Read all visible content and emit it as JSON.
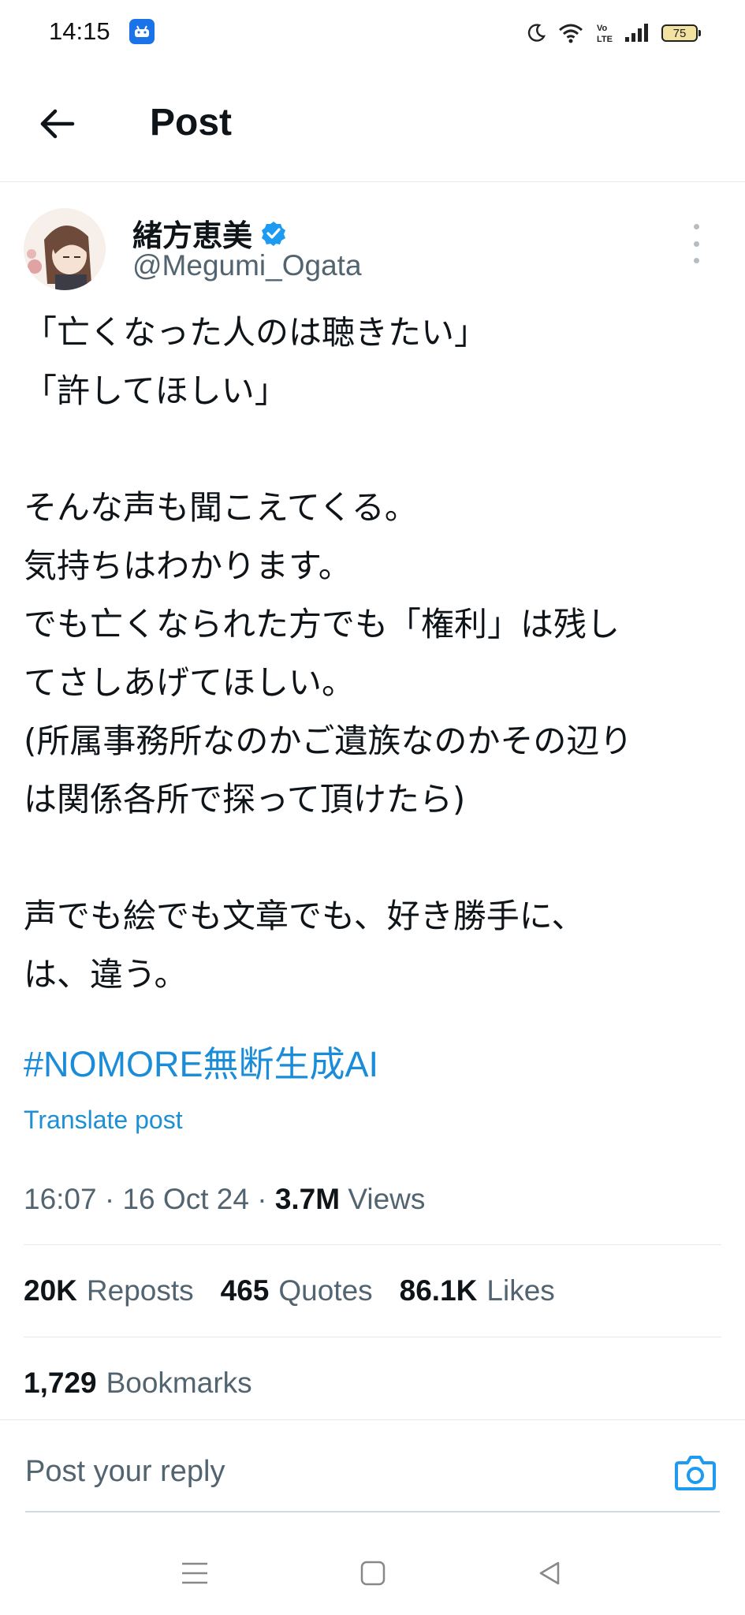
{
  "status_bar": {
    "time": "14:15",
    "battery": "75",
    "network_label": "Vo LTE"
  },
  "header": {
    "title": "Post"
  },
  "post": {
    "author_name": "緒方恵美",
    "author_handle": "@Megumi_Ogata",
    "verified": true,
    "body": "「亡くなった人のは聴きたい」\n「許してほしい」\n\nそんな声も聞こえてくる。\n気持ちはわかります。\nでも亡くなられた方でも「権利」は残し\nてさしあげてほしい。\n(所属事務所なのかご遺族なのかその辺り\nは関係各所で探って頂けたら)\n\n声でも絵でも文章でも、好き勝手に、\nは、違う。",
    "hashtag": "#NOMORE無断生成AI",
    "translate_label": "Translate post",
    "time": "16:07",
    "date": "16 Oct 24",
    "views_count": "3.7M",
    "views_label": "Views"
  },
  "stats": {
    "reposts_count": "20K",
    "reposts_label": "Reposts",
    "quotes_count": "465",
    "quotes_label": "Quotes",
    "likes_count": "86.1K",
    "likes_label": "Likes",
    "bookmarks_count": "1,729",
    "bookmarks_label": "Bookmarks"
  },
  "reply": {
    "placeholder": "Post your reply"
  },
  "colors": {
    "accent": "#1d9bf0",
    "text": "#0f1419",
    "muted": "#536471"
  }
}
